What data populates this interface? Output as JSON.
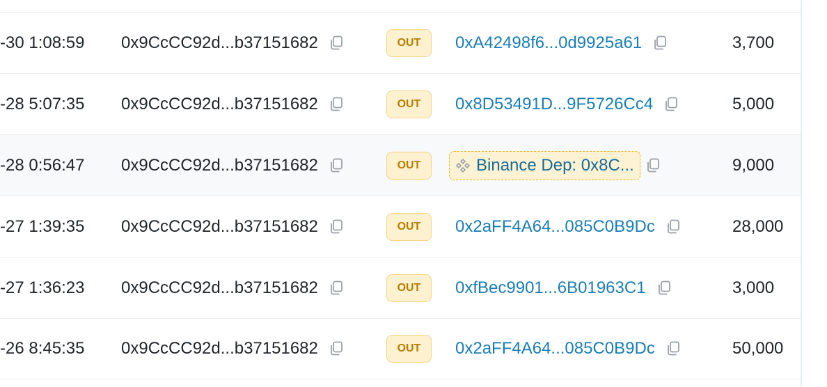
{
  "colors": {
    "link": "#1a7db6",
    "badge_text": "#b47d00",
    "badge_bg": "#fdf1cf",
    "named_tag_border": "#e8b417"
  },
  "rows": [
    {
      "age": "-30 1:08:59",
      "from": "0x9CcCC92d...b37151682",
      "direction": "OUT",
      "to": "0xA42498f6...0d9925a61",
      "to_named": false,
      "value": "3,700"
    },
    {
      "age": "-28 5:07:35",
      "from": "0x9CcCC92d...b37151682",
      "direction": "OUT",
      "to": "0x8D53491D...9F5726Cc4",
      "to_named": false,
      "value": "5,000"
    },
    {
      "age": "-28 0:56:47",
      "from": "0x9CcCC92d...b37151682",
      "direction": "OUT",
      "to": "Binance Dep: 0x8C...",
      "to_named": true,
      "to_icon": "binance-diamond-icon",
      "value": "9,000"
    },
    {
      "age": "-27 1:39:35",
      "from": "0x9CcCC92d...b37151682",
      "direction": "OUT",
      "to": "0x2aFF4A64...085C0B9Dc",
      "to_named": false,
      "value": "28,000"
    },
    {
      "age": "-27 1:36:23",
      "from": "0x9CcCC92d...b37151682",
      "direction": "OUT",
      "to": "0xfBec9901...6B01963C1",
      "to_named": false,
      "value": "3,000"
    },
    {
      "age": "-26 8:45:35",
      "from": "0x9CcCC92d...b37151682",
      "direction": "OUT",
      "to": "0x2aFF4A64...085C0B9Dc",
      "to_named": false,
      "value": "50,000"
    }
  ]
}
